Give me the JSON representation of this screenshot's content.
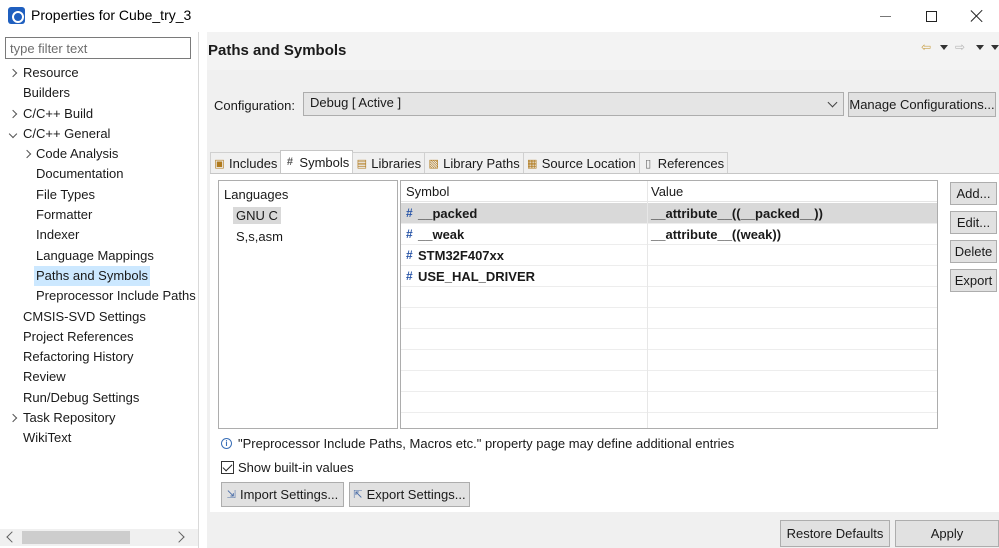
{
  "window": {
    "title": "Properties for Cube_try_3"
  },
  "filter": {
    "placeholder": "type filter text"
  },
  "tree": {
    "items": [
      {
        "label": "Resource"
      },
      {
        "label": "Builders"
      },
      {
        "label": "C/C++ Build"
      },
      {
        "label": "C/C++ General"
      },
      {
        "label": "Code Analysis"
      },
      {
        "label": "Documentation"
      },
      {
        "label": "File Types"
      },
      {
        "label": "Formatter"
      },
      {
        "label": "Indexer"
      },
      {
        "label": "Language Mappings"
      },
      {
        "label": "Paths and Symbols"
      },
      {
        "label": "Preprocessor Include Paths"
      },
      {
        "label": "CMSIS-SVD Settings"
      },
      {
        "label": "Project References"
      },
      {
        "label": "Refactoring History"
      },
      {
        "label": "Review"
      },
      {
        "label": "Run/Debug Settings"
      },
      {
        "label": "Task Repository"
      },
      {
        "label": "WikiText"
      }
    ]
  },
  "page": {
    "title": "Paths and Symbols",
    "config_label": "Configuration:",
    "config_value": "Debug  [ Active ]",
    "manage_label": "Manage Configurations..."
  },
  "tabs": {
    "items": [
      {
        "label": "Includes"
      },
      {
        "label": "Symbols"
      },
      {
        "label": "Libraries"
      },
      {
        "label": "Library Paths"
      },
      {
        "label": "Source Location"
      },
      {
        "label": "References"
      }
    ]
  },
  "languages": {
    "header": "Languages",
    "items": [
      "GNU C",
      "S,s,asm"
    ]
  },
  "symbols": {
    "col_symbol": "Symbol",
    "col_value": "Value",
    "rows": [
      {
        "symbol": "__packed",
        "value": "__attribute__((__packed__))"
      },
      {
        "symbol": "__weak",
        "value": "__attribute__((weak))"
      },
      {
        "symbol": "STM32F407xx",
        "value": ""
      },
      {
        "symbol": "USE_HAL_DRIVER",
        "value": ""
      }
    ]
  },
  "actions": {
    "add": "Add...",
    "edit": "Edit...",
    "delete": "Delete",
    "export": "Export"
  },
  "info": {
    "text": "\"Preprocessor Include Paths, Macros etc.\" property page may define additional entries"
  },
  "show_builtin": {
    "label": "Show built-in values"
  },
  "settings_buttons": {
    "import": "Import Settings...",
    "export": "Export Settings..."
  },
  "footer": {
    "restore": "Restore Defaults",
    "apply": "Apply"
  },
  "icons": {
    "app": "app-icon",
    "minimize": "minimize-icon",
    "maximize": "maximize-icon",
    "close": "close-icon",
    "back": "back-arrow-icon",
    "forward": "forward-arrow-icon",
    "info": "info-icon"
  },
  "colors": {
    "selection": "#cce8ff",
    "accent": "#1f5fbf",
    "panel": "#f0f0f0"
  }
}
